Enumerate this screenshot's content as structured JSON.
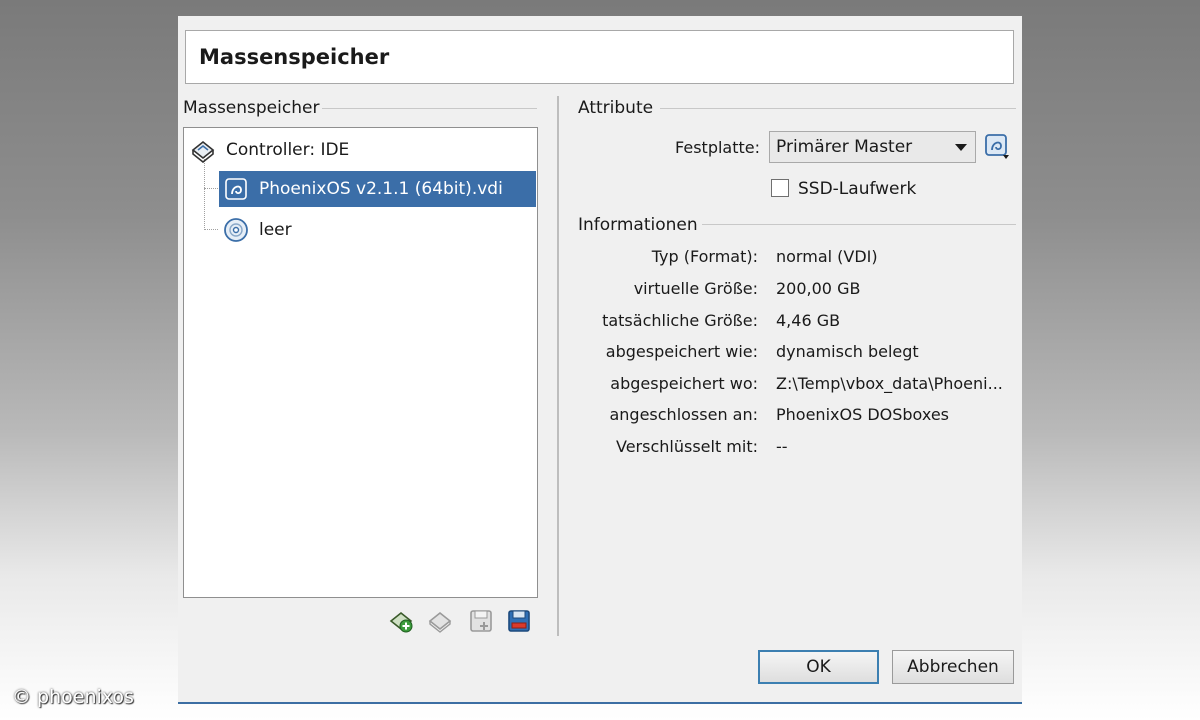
{
  "dialog": {
    "title": "Massenspeicher",
    "ok_label": "OK",
    "cancel_label": "Abbrechen"
  },
  "storage": {
    "group_label": "Massenspeicher",
    "controller_label": "Controller: IDE",
    "items": [
      {
        "label": "PhoenixOS v2.1.1 (64bit).vdi",
        "icon": "hard-disk-icon",
        "selected": true
      },
      {
        "label": "leer",
        "icon": "optical-disc-icon",
        "selected": false
      }
    ],
    "toolbar": [
      "add-controller-icon",
      "remove-controller-icon",
      "add-attachment-icon",
      "remove-attachment-icon"
    ]
  },
  "attributes": {
    "group_label": "Attribute",
    "harddisk_label": "Festplatte:",
    "harddisk_value": "Primärer Master",
    "ssd_label": "SSD-Laufwerk",
    "ssd_checked": false
  },
  "information": {
    "group_label": "Informationen",
    "rows": [
      {
        "label": "Typ (Format):",
        "value": "normal (VDI)"
      },
      {
        "label": "virtuelle Größe:",
        "value": "200,00 GB"
      },
      {
        "label": "tatsächliche Größe:",
        "value": "4,46 GB"
      },
      {
        "label": "abgespeichert wie:",
        "value": "dynamisch belegt"
      },
      {
        "label": "abgespeichert wo:",
        "value": "Z:\\Temp\\vbox_data\\Phoeni..."
      },
      {
        "label": "angeschlossen an:",
        "value": "PhoenixOS DOSboxes"
      },
      {
        "label": "Verschlüsselt mit:",
        "value": "--"
      }
    ]
  },
  "watermark": "© phoenixos",
  "colors": {
    "selection": "#3b6ea8",
    "default_button_border": "#3c7fb1"
  }
}
